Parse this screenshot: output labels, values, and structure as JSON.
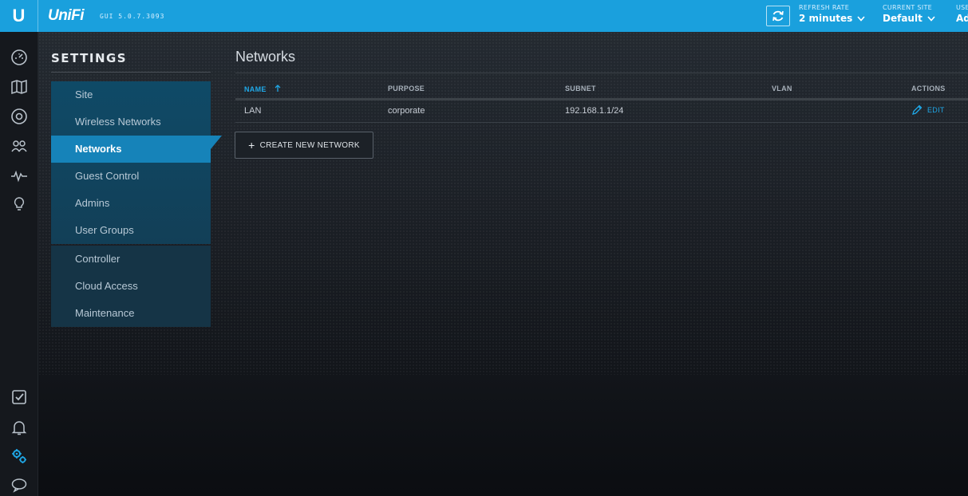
{
  "topbar": {
    "brand": "UniFi",
    "logo_letter": "U",
    "version": "GUI 5.0.7.3093",
    "refresh_rate_caption": "REFRESH RATE",
    "refresh_rate_value": "2 minutes",
    "current_site_caption": "CURRENT SITE",
    "current_site_value": "Default",
    "user_caption": "USE",
    "user_value": "Ad",
    "accent_color": "#1aa0dd"
  },
  "rail": {
    "top_icons": [
      "dashboard-icon",
      "map-icon",
      "devices-icon",
      "clients-icon",
      "statistics-icon",
      "insights-icon"
    ],
    "bottom_icons": [
      "events-icon",
      "alerts-icon",
      "settings-icon",
      "chat-icon"
    ],
    "active": "settings-icon"
  },
  "settings": {
    "title": "SETTINGS",
    "items": [
      {
        "label": "Site"
      },
      {
        "label": "Wireless Networks"
      },
      {
        "label": "Networks"
      },
      {
        "label": "Guest Control"
      },
      {
        "label": "Admins"
      },
      {
        "label": "User Groups"
      },
      {
        "label": "Controller"
      },
      {
        "label": "Cloud Access"
      },
      {
        "label": "Maintenance"
      }
    ],
    "active": "Networks"
  },
  "page": {
    "title": "Networks",
    "columns": {
      "name": "NAME",
      "purpose": "PURPOSE",
      "subnet": "SUBNET",
      "vlan": "VLAN",
      "actions": "ACTIONS"
    },
    "rows": [
      {
        "name": "LAN",
        "purpose": "corporate",
        "subnet": "192.168.1.1/24",
        "vlan": "",
        "action": "EDIT"
      }
    ],
    "create_button": "CREATE NEW NETWORK"
  }
}
